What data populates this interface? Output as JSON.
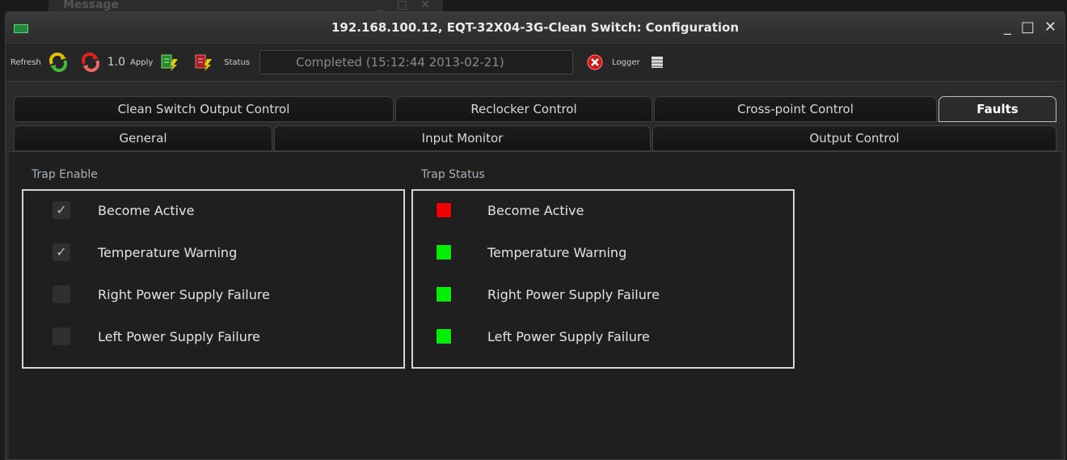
{
  "background_window": {
    "title": "Message"
  },
  "window": {
    "title": "192.168.100.12, EQT-32X04-3G-Clean Switch: Configuration",
    "controls": [
      "_",
      "□",
      "✕"
    ]
  },
  "toolbar": {
    "refresh_label": "Refresh",
    "zoom_value": "1.0",
    "apply_label": "Apply",
    "status_label": "Status",
    "status_value": "Completed  (15:12:44  2013-02-21)",
    "logger_label": "Logger"
  },
  "tabs_row1": [
    {
      "label": "Clean Switch Output Control"
    },
    {
      "label": "Reclocker Control"
    },
    {
      "label": "Cross-point Control"
    },
    {
      "label": "Faults",
      "active": true
    }
  ],
  "tabs_row2": [
    {
      "label": "General"
    },
    {
      "label": "Input Monitor"
    },
    {
      "label": "Output Control"
    }
  ],
  "trap_enable": {
    "title": "Trap Enable",
    "items": [
      {
        "label": "Become Active",
        "checked": true
      },
      {
        "label": "Temperature Warning",
        "checked": true
      },
      {
        "label": "Right Power Supply Failure",
        "checked": false
      },
      {
        "label": "Left Power Supply Failure",
        "checked": false
      }
    ]
  },
  "trap_status": {
    "title": "Trap Status",
    "items": [
      {
        "label": "Become Active",
        "color": "#ee0000"
      },
      {
        "label": "Temperature Warning",
        "color": "#00ee00"
      },
      {
        "label": "Right Power Supply Failure",
        "color": "#00ee00"
      },
      {
        "label": "Left Power Supply Failure",
        "color": "#00ee00"
      }
    ]
  }
}
